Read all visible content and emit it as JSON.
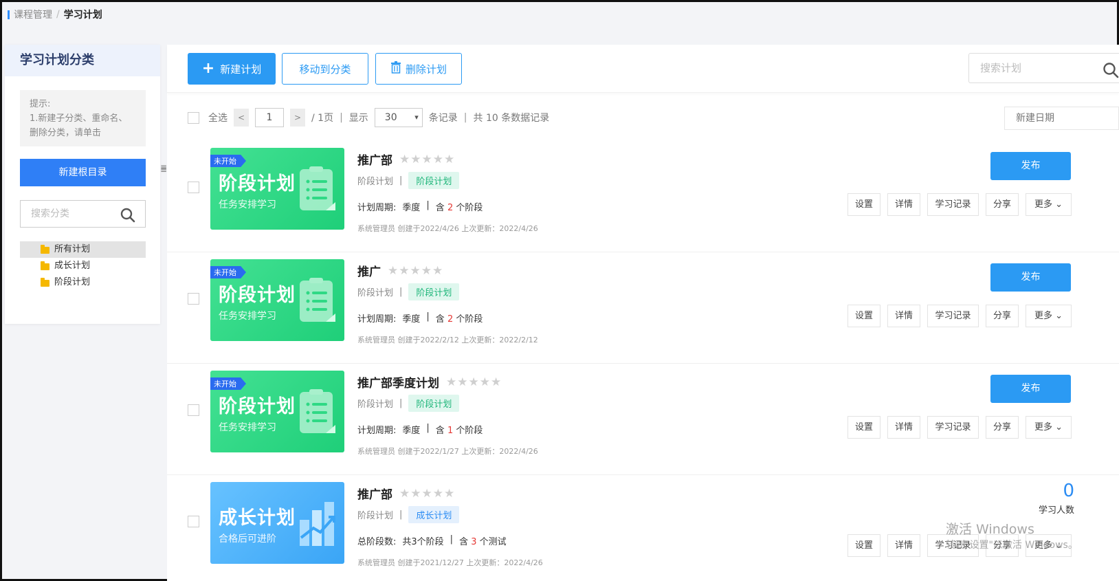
{
  "breadcrumb": {
    "parent": "课程管理",
    "sep": "/",
    "current": "学习计划"
  },
  "sidebar": {
    "title": "学习计划分类",
    "tip_line1": "提示:",
    "tip_line2": "1.新建子分类、重命名、删除分类，请单击",
    "new_root_label": "新建根目录",
    "search_placeholder": "搜索分类",
    "tree": [
      {
        "label": "所有计划",
        "active": true
      },
      {
        "label": "成长计划",
        "active": false
      },
      {
        "label": "阶段计划",
        "active": false
      }
    ]
  },
  "toolbar": {
    "new_label": "新建计划",
    "move_label": "移动到分类",
    "delete_label": "删除计划",
    "search_placeholder": "搜索计划"
  },
  "pager": {
    "select_all": "全选",
    "current_page": "1",
    "total_pages": "/ 1页",
    "show": "显示",
    "page_size": "30",
    "records": "条记录",
    "total": "共 10 条数据记录",
    "sort": "新建日期"
  },
  "common": {
    "badge": "未开始",
    "stars": "★★★★★",
    "publish": "发布",
    "set": "设置",
    "detail": "详情",
    "record": "学习记录",
    "share": "分享",
    "more": "更多 ⌄"
  },
  "plans": [
    {
      "name": "推广部",
      "type": "阶段计划",
      "tag": "阶段计划",
      "cover_title": "阶段计划",
      "cover_sub": "任务安排学习",
      "period_label": "计划周期:",
      "period_value": "季度",
      "contains_pre": "含",
      "contains_num": "2",
      "contains_post": "个阶段",
      "footer": "系统管理员 创建于2022/4/26 上次更新：2022/4/26"
    },
    {
      "name": "推广",
      "type": "阶段计划",
      "tag": "阶段计划",
      "cover_title": "阶段计划",
      "cover_sub": "任务安排学习",
      "period_label": "计划周期:",
      "period_value": "季度",
      "contains_pre": "含",
      "contains_num": "2",
      "contains_post": "个阶段",
      "footer": "系统管理员 创建于2022/2/12 上次更新：2022/2/12"
    },
    {
      "name": "推广部季度计划",
      "type": "阶段计划",
      "tag": "阶段计划",
      "cover_title": "阶段计划",
      "cover_sub": "任务安排学习",
      "period_label": "计划周期:",
      "period_value": "季度",
      "contains_pre": "含",
      "contains_num": "1",
      "contains_post": "个阶段",
      "footer": "系统管理员 创建于2022/1/27 上次更新：2022/4/26"
    },
    {
      "name": "推广部",
      "type": "阶段计划",
      "tag": "成长计划",
      "cover_title": "成长计划",
      "cover_sub": "合格后可进阶",
      "period_label": "总阶段数:",
      "period_value": "共3个阶段",
      "contains_pre": "含",
      "contains_num": "3",
      "contains_post": "个测试",
      "footer": "系统管理员 创建于2021/12/27 上次更新：2022/4/26",
      "learners_count": "0",
      "learners_label": "学习人数"
    }
  ],
  "watermark": {
    "line1": "激活 Windows",
    "line2": "转到\"设置\"以激活 Windows。"
  },
  "colors": {
    "primary": "#2b9af3",
    "green_cover": "#2fd985",
    "blue_cover": "#4fb3fa",
    "accent_red": "#e53935"
  }
}
